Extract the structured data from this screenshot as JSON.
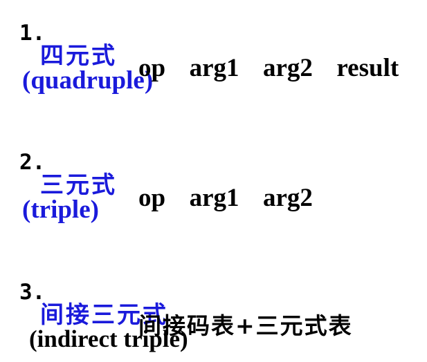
{
  "colors": {
    "heading_accent": "#1a1adb",
    "text": "#000000",
    "background": "#ffffff"
  },
  "items": [
    {
      "number": "1.",
      "term_zh": "四元式",
      "term_en": "(quadruple)",
      "fields": "op  arg1  arg2  result"
    },
    {
      "number": "2.",
      "term_zh": "三元式",
      "term_en": "(triple)",
      "fields": "op  arg1  arg2"
    },
    {
      "number": "3.",
      "term_zh": "间接三元式",
      "term_en": "(indirect triple)",
      "fields": "间接码表+三元式表"
    }
  ]
}
